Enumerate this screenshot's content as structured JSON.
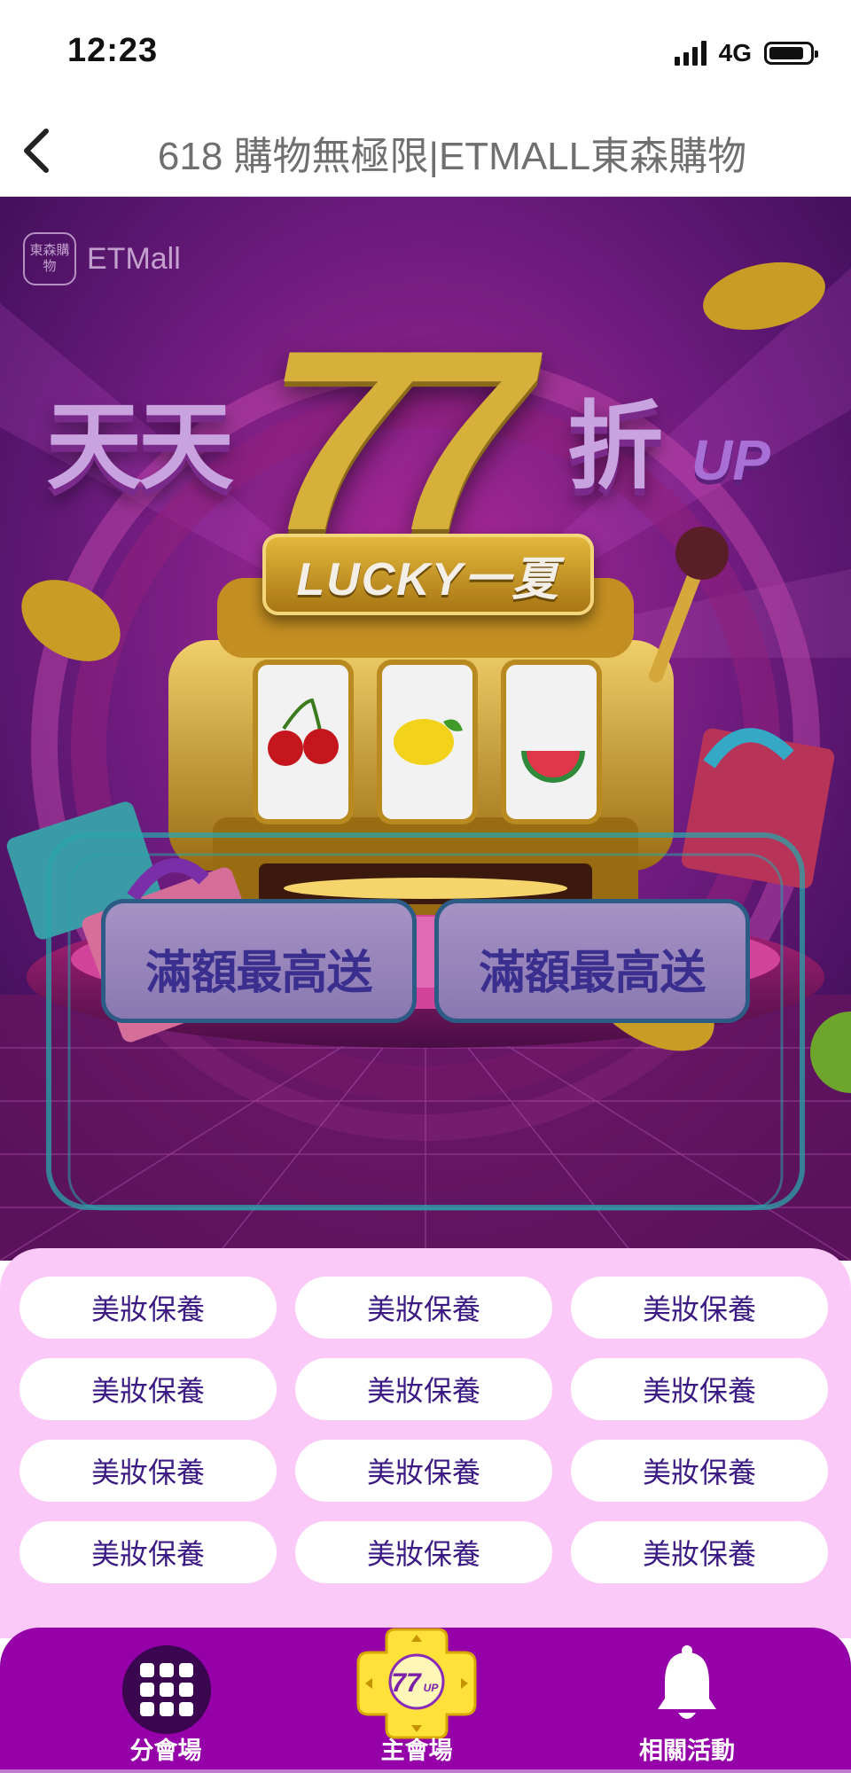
{
  "status_bar": {
    "time": "12:23",
    "network": "4G"
  },
  "nav": {
    "title": "618 購物無極限|ETMALL東森購物",
    "back_icon": "chevron-left-icon"
  },
  "banner": {
    "logo_seal": "東森購物",
    "logo_text": "ETMall",
    "headline_left": "天天",
    "headline_number": "77",
    "headline_right": "折",
    "headline_suffix": "UP",
    "plate_text": "LUCKY一夏",
    "badges": [
      "滿額最高送",
      "滿額最高送"
    ]
  },
  "categories": [
    "美妝保養",
    "美妝保養",
    "美妝保養",
    "美妝保養",
    "美妝保養",
    "美妝保養",
    "美妝保養",
    "美妝保養",
    "美妝保養",
    "美妝保養",
    "美妝保養",
    "美妝保養"
  ],
  "tab_bar": {
    "left": {
      "label": "分會場",
      "icon": "grid-icon"
    },
    "center": {
      "label": "主會場",
      "icon": "77up-badge-icon",
      "badge_text": "77",
      "badge_suffix": "UP"
    },
    "right": {
      "label": "相關活動",
      "icon": "bell-icon"
    }
  },
  "colors": {
    "panel_bg": "#fbc9f7",
    "pill_text": "#3c1a83",
    "tab_bar": "#9500a9",
    "banner_purple": "#5a1a6e"
  }
}
